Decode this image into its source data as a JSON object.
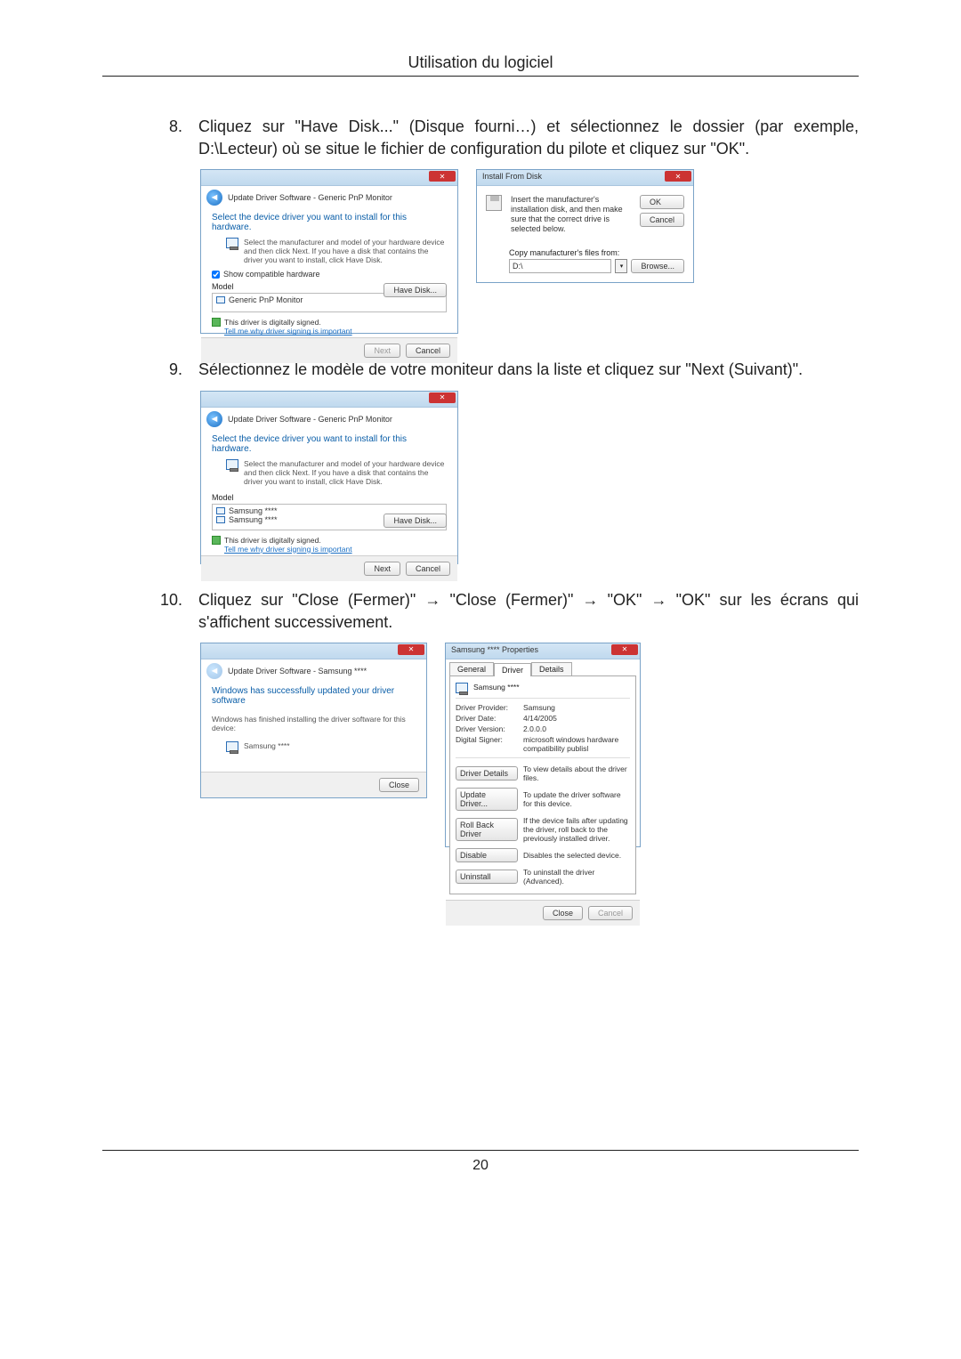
{
  "header": "Utilisation du logiciel",
  "steps": {
    "s8": {
      "num": "8.",
      "txt": "Cliquez sur \"Have Disk...\" (Disque fourni…) et sélectionnez le dossier (par exemple, D:\\Lecteur) où se situe le fichier de configuration du pilote et cliquez sur \"OK\"."
    },
    "s9": {
      "num": "9.",
      "txt": "Sélectionnez le modèle de votre moniteur dans la liste et cliquez sur \"Next (Suivant)\"."
    },
    "s10": {
      "num": "10.",
      "txt": "Cliquez sur \"Close (Fermer)\" → \"Close (Fermer)\" → \"OK\" → \"OK\" sur les écrans qui s'affichent successivement."
    }
  },
  "dlgA": {
    "bread": "Update Driver Software - Generic PnP Monitor",
    "headline": "Select the device driver you want to install for this hardware.",
    "hint": "Select the manufacturer and model of your hardware device and then click Next. If you have a disk that contains the driver you want to install, click Have Disk.",
    "compat": "Show compatible hardware",
    "listlbl": "Model",
    "item": "Generic PnP Monitor",
    "signed": "This driver is digitally signed.",
    "signlink": "Tell me why driver signing is important",
    "havedisk": "Have Disk...",
    "next": "Next",
    "cancel": "Cancel"
  },
  "dlgB": {
    "title": "Install From Disk",
    "msg": "Insert the manufacturer's installation disk, and then make sure that the correct drive is selected below.",
    "ok": "OK",
    "cancel": "Cancel",
    "copy": "Copy manufacturer's files from:",
    "path": "D:\\",
    "browse": "Browse..."
  },
  "dlgC": {
    "bread": "Update Driver Software - Generic PnP Monitor",
    "headline": "Select the device driver you want to install for this hardware.",
    "hint": "Select the manufacturer and model of your hardware device and then click Next. If you have a disk that contains the driver you want to install, click Have Disk.",
    "listlbl": "Model",
    "item1": "Samsung ****",
    "item2": "Samsung ****",
    "signed": "This driver is digitally signed.",
    "signlink": "Tell me why driver signing is important",
    "havedisk": "Have Disk...",
    "next": "Next",
    "cancel": "Cancel"
  },
  "dlgD": {
    "bread": "Update Driver Software - Samsung ****",
    "headline": "Windows has successfully updated your driver software",
    "sub": "Windows has finished installing the driver software for this device:",
    "item": "Samsung ****",
    "close": "Close"
  },
  "dlgE": {
    "title": "Samsung **** Properties",
    "tab_general": "General",
    "tab_driver": "Driver",
    "tab_details": "Details",
    "device": "Samsung ****",
    "rows": {
      "provider_k": "Driver Provider:",
      "provider_v": "Samsung",
      "date_k": "Driver Date:",
      "date_v": "4/14/2005",
      "version_k": "Driver Version:",
      "version_v": "2.0.0.0",
      "signer_k": "Digital Signer:",
      "signer_v": "microsoft windows hardware compatibility publisl"
    },
    "actions": {
      "details_b": "Driver Details",
      "details_t": "To view details about the driver files.",
      "update_b": "Update Driver...",
      "update_t": "To update the driver software for this device.",
      "roll_b": "Roll Back Driver",
      "roll_t": "If the device fails after updating the driver, roll back to the previously installed driver.",
      "disable_b": "Disable",
      "disable_t": "Disables the selected device.",
      "uninstall_b": "Uninstall",
      "uninstall_t": "To uninstall the driver (Advanced)."
    },
    "close": "Close",
    "cancel": "Cancel"
  },
  "pagenum": "20"
}
